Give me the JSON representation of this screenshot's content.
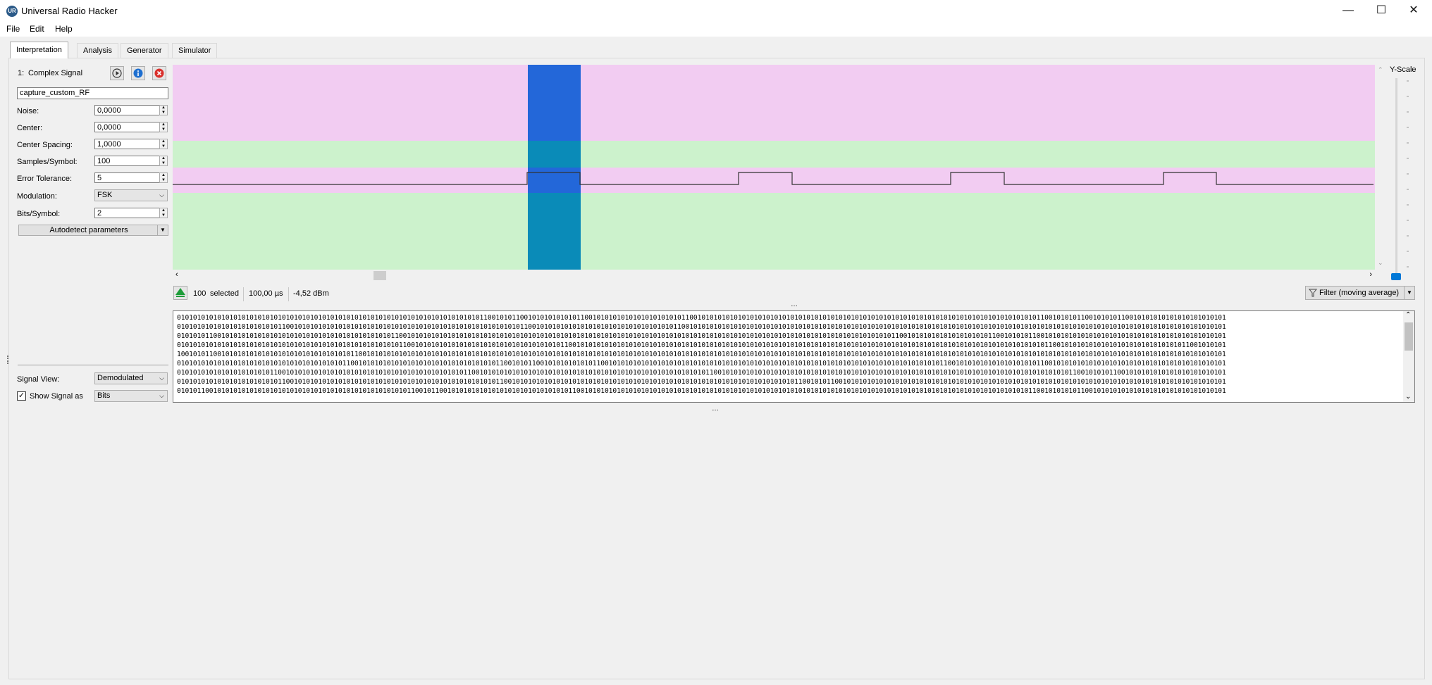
{
  "window": {
    "title": "Universal Radio Hacker",
    "logo_text": "UR",
    "minimize_glyph": "—",
    "maximize_glyph": "☐",
    "close_glyph": "✕"
  },
  "menu": {
    "items": [
      "File",
      "Edit",
      "Help"
    ]
  },
  "tabs": [
    "Interpretation",
    "Analysis",
    "Generator",
    "Simulator"
  ],
  "signal": {
    "index_label": "1:",
    "name": "Complex Signal",
    "filename": "capture_custom_RF",
    "params": [
      {
        "label": "Noise:",
        "value": "0,0000"
      },
      {
        "label": "Center:",
        "value": "0,0000"
      },
      {
        "label": "Center Spacing:",
        "value": "1,0000"
      },
      {
        "label": "Samples/Symbol:",
        "value": "100"
      },
      {
        "label": "Error Tolerance:",
        "value": "5"
      }
    ],
    "modulation_label": "Modulation:",
    "modulation_value": "FSK",
    "bits_per_symbol_label": "Bits/Symbol:",
    "bits_per_symbol_value": "2",
    "autodetect_label": "Autodetect parameters",
    "signal_view_label": "Signal View:",
    "signal_view_value": "Demodulated",
    "show_signal_as_label": "Show Signal as",
    "show_signal_as_value": "Bits",
    "show_signal_as_checked": true
  },
  "status": {
    "selected_count": "100",
    "selected_label": "selected",
    "duration": "100,00 µs",
    "power": "-4,52 dBm",
    "filter_label": "Filter (moving average)"
  },
  "yscale": {
    "label": "Y-Scale"
  },
  "colors": {
    "magenta_band": "#f2ccf2",
    "green_band": "#ccf2cc",
    "selection_blue": "#2367d9",
    "selection_teal": "#0a8bb8",
    "accent": "#0078d7"
  },
  "bits": [
    "01010101010101010101010101010101010101010101010101010101010101010101010101011001010110010101010101011001010101010101010101010110010101010101010101010101010101010101010101010101010101010101010101010101010101010101011001010101100101010110010101010101010101010101",
    "01010101010101010101010101100101010101010101010101010101010101010101010101010101010101100101010101010101010101010101010101011001010101010101010101010101010101010101010101010101010101010101010101010101010101010101010101010101010101010101010101010101010101010101",
    "01010101100101010101010101010101010101010101010101010110010101010101010101010101010101010101010101010101010101010101010101010101010101010101010101010101010101010101010101010101011001010101010101010101011001010101100101010101010101010101010101010101010101010101",
    "01010101010101010101010101010101010101010101010101010101100101010101010101010101010101010101010110010101010101010101010101010101010101010101010101010101010101010101010101010101010101010101010101010101010101010101010110010101010101010101010101010101011001010101",
    "10010101100101010101010101010101010101010101100101010101010101010101010101010101010101010101010101010101010101010101010101010101010101010101010101010101010101010101010101010101010101010101010101010101010101010101010101010101010101010101010101010101010101010101",
    "01010101010101010101010101010101010101010110010101010101010101010101010101010101100101011001010101010101100101010101010101010101010101010101010101010101010101010101010101010101010101010101011001010101010101010101011001010101010101010101010101010101010101010101",
    "01010101010101010101010110010101010101010101010101010101010101010101010110010101010101010101010101010101010101010101010101010101010110010101010101010101010101010101010101010101010101010101010101010101010101010101010101010110010101011001010101010101010101010101",
    "01010101010101010101010101100101010101010101010101010101010101010101010101010101100101010101010101010101010101010101010101010101010101010101010101010101011001010110010101010101010101010101010101010101010101010101010101010101010101010101010101010101010101010101",
    "01010110010101010101010101010101010101010101010101010101011001011001010101010101010101010101010101100101010101010101010101010101010101010101010101010101010101010101010101010101010101010101010101010101010101010101100101010101100101010101010101010101010101010101"
  ]
}
